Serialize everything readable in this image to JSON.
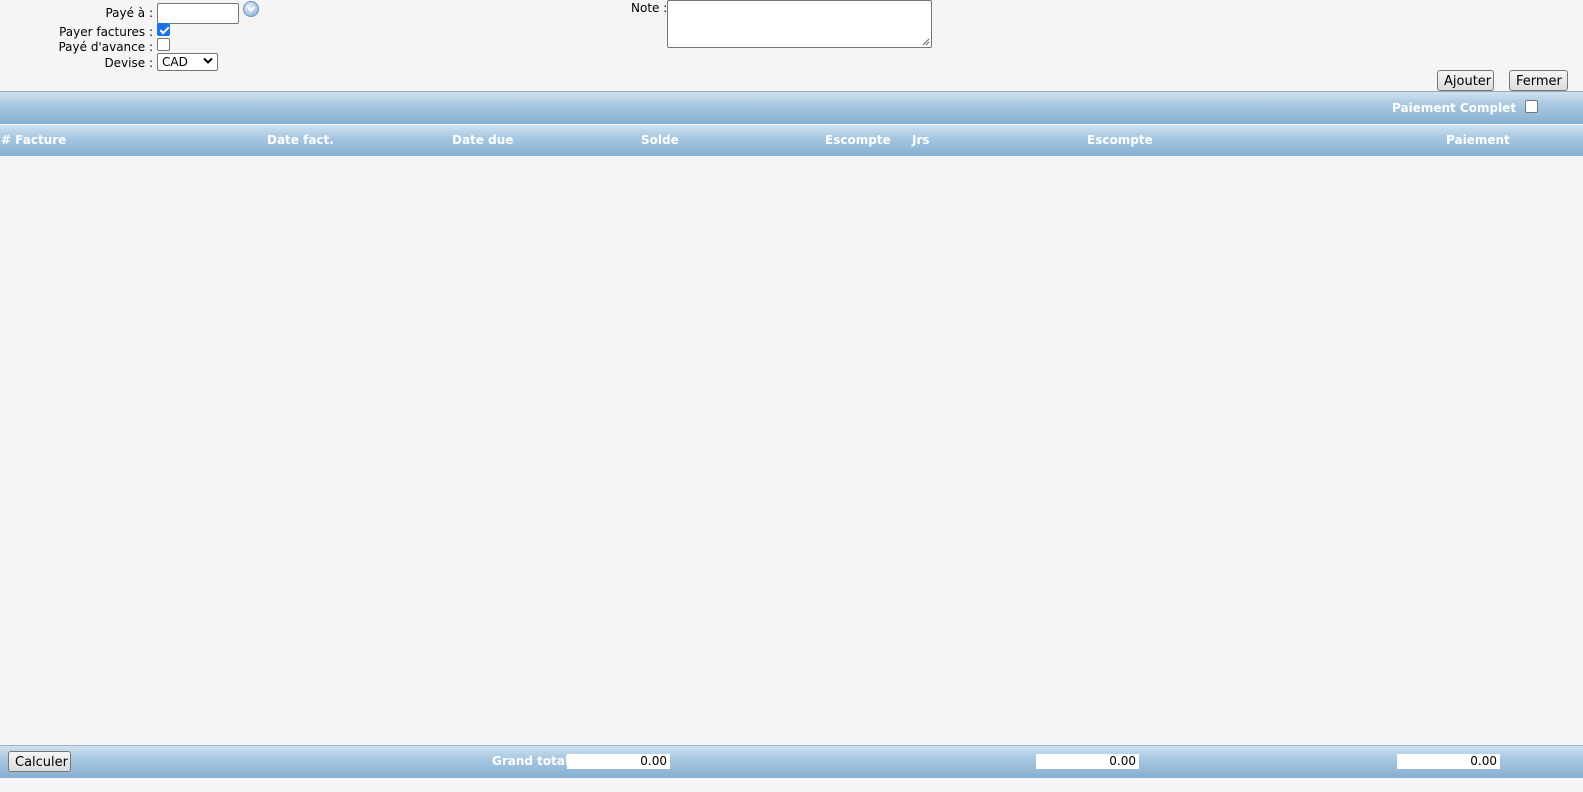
{
  "form": {
    "paye_a_label": "Payé à :",
    "paye_a_value": "",
    "payer_factures_label": "Payer factures :",
    "payer_factures_checked": true,
    "paye_avance_label": "Payé d'avance :",
    "paye_avance_checked": false,
    "devise_label": "Devise :",
    "devise_value": "CAD",
    "note_label": "Note :",
    "note_value": ""
  },
  "actions": {
    "ajouter_label": "Ajouter",
    "fermer_label": "Fermer"
  },
  "table": {
    "paiement_complet_label": "Paiement Complet",
    "paiement_complet_checked": false,
    "columns": [
      "# Facture",
      "Date fact.",
      "Date due",
      "Solde",
      "Escompte",
      "Jrs",
      "Escompte",
      "Paiement"
    ],
    "rows": []
  },
  "footer": {
    "calculer_label": "Calculer",
    "grand_total_label": "Grand total:",
    "total_solde": "0.00",
    "total_escompte": "0.00",
    "total_paiement": "0.00"
  },
  "colors": {
    "header_bar": "#a8c8e1",
    "checkbox_checked": "#1a73e8",
    "background": "#f5f5f5"
  },
  "icons": {
    "lookup": "chevron-down-circle-icon",
    "select": "chevron-down-icon",
    "resize": "resize-grip-icon"
  }
}
